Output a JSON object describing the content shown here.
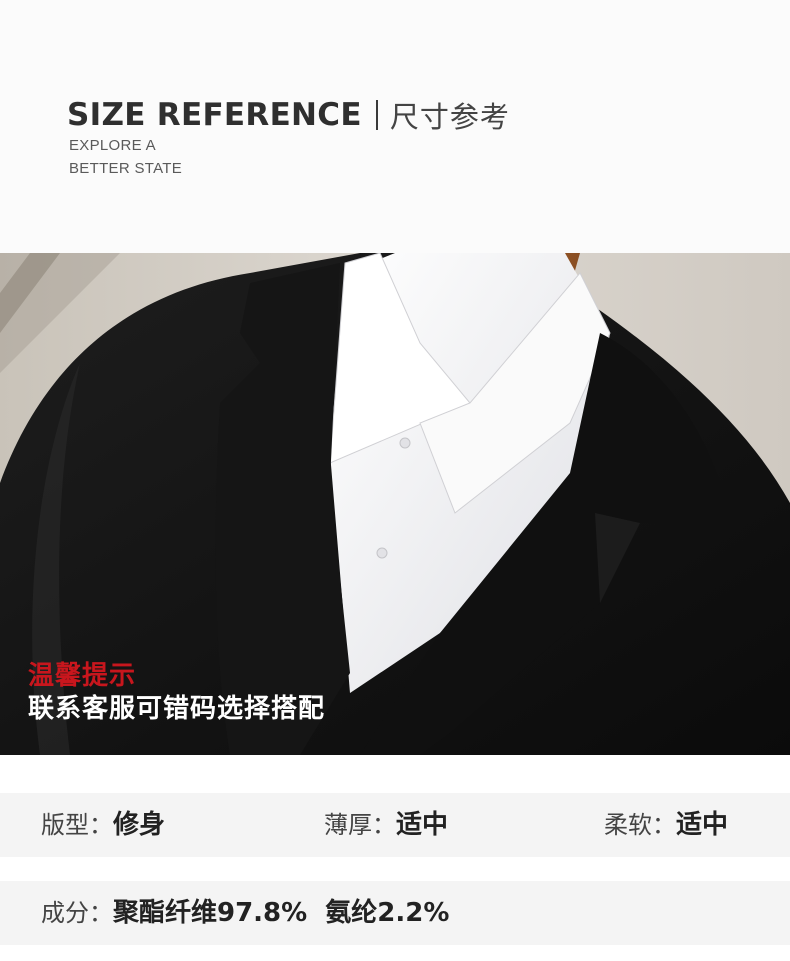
{
  "header": {
    "title_en": "SIZE REFERENCE",
    "title_cn": "尺寸参考",
    "subtitle_line1": "EXPLORE A",
    "subtitle_line2": "BETTER STATE"
  },
  "tip": {
    "title": "温馨提示",
    "text": "联系客服可错码选择搭配"
  },
  "specs": {
    "fit": {
      "label": "版型：",
      "value": "修身"
    },
    "thickness": {
      "label": "薄厚：",
      "value": "适中"
    },
    "softness": {
      "label": "柔软：",
      "value": "适中"
    },
    "composition": {
      "label": "成分：",
      "value": "聚酯纤维97.8%  氨纶2.2%"
    }
  },
  "colors": {
    "tip_title": "#c8161d",
    "suit": "#141414",
    "shirt": "#f3f3f5",
    "hanger": "#a0622f",
    "bar_bg": "#f4f4f4"
  }
}
